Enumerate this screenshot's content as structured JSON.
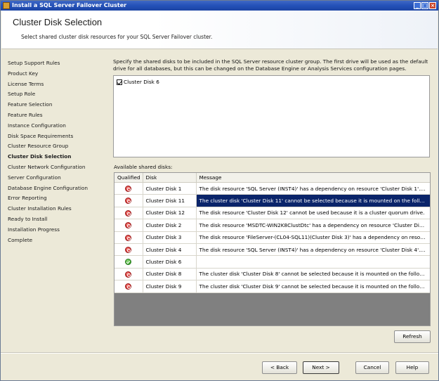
{
  "window": {
    "title": "Install a SQL Server Failover Cluster"
  },
  "header": {
    "title": "Cluster Disk Selection",
    "subtitle": "Select shared cluster disk resources for your SQL Server Failover cluster."
  },
  "nav": {
    "items": [
      {
        "label": "Setup Support Rules"
      },
      {
        "label": "Product Key"
      },
      {
        "label": "License Terms"
      },
      {
        "label": "Setup Role"
      },
      {
        "label": "Feature Selection"
      },
      {
        "label": "Feature Rules"
      },
      {
        "label": "Instance Configuration"
      },
      {
        "label": "Disk Space Requirements"
      },
      {
        "label": "Cluster Resource Group"
      },
      {
        "label": "Cluster Disk Selection"
      },
      {
        "label": "Cluster Network Configuration"
      },
      {
        "label": "Server Configuration"
      },
      {
        "label": "Database Engine Configuration"
      },
      {
        "label": "Error Reporting"
      },
      {
        "label": "Cluster Installation Rules"
      },
      {
        "label": "Ready to Install"
      },
      {
        "label": "Installation Progress"
      },
      {
        "label": "Complete"
      }
    ],
    "active_index": 9
  },
  "main": {
    "description": "Specify the shared disks to be included in the SQL Server resource cluster group. The first drive will be used as the default drive for all databases, but this can be changed on the Database Engine or Analysis Services configuration pages.",
    "selected_disks": [
      {
        "label": "Cluster Disk 6",
        "checked": true
      }
    ],
    "available_label": "Available shared disks:",
    "grid": {
      "columns": [
        "Qualified",
        "Disk",
        "Message"
      ],
      "rows": [
        {
          "status": "error",
          "disk": "Cluster Disk 1",
          "message": "The disk resource 'SQL Server (INST4)' has a dependency on resource 'Cluster Disk 1'. To ..."
        },
        {
          "status": "error",
          "disk": "Cluster Disk 11",
          "message": "The cluster disk 'Cluster Disk 11' cannot be selected because it is mounted on the followin...",
          "selected": true
        },
        {
          "status": "error",
          "disk": "Cluster Disk 12",
          "message": "The disk resource 'Cluster Disk 12' cannot be used because it is a cluster quorum drive."
        },
        {
          "status": "error",
          "disk": "Cluster Disk 2",
          "message": "The disk resource 'MSDTC-WIN2K8ClustDtc' has a dependency on resource 'Cluster Disk 2'..."
        },
        {
          "status": "error",
          "disk": "Cluster Disk 3",
          "message": "The disk resource 'FileServer-(CL04-SQL11)(Cluster Disk 3)' has a dependency on resourc..."
        },
        {
          "status": "error",
          "disk": "Cluster Disk 4",
          "message": "The disk resource 'SQL Server (INST4)' has a dependency on resource 'Cluster Disk 4'. To ..."
        },
        {
          "status": "ok",
          "disk": "Cluster Disk 6",
          "message": ""
        },
        {
          "status": "error",
          "disk": "Cluster Disk 8",
          "message": "The cluster disk 'Cluster Disk 8' cannot be selected because it is mounted on the following ..."
        },
        {
          "status": "error",
          "disk": "Cluster Disk 9",
          "message": "The cluster disk 'Cluster Disk 9' cannot be selected because it is mounted on the following ..."
        }
      ]
    },
    "refresh_label": "Refresh"
  },
  "footer": {
    "back_label": "< Back",
    "next_label": "Next >",
    "cancel_label": "Cancel",
    "help_label": "Help"
  },
  "icons": {
    "error": "error-circle-icon",
    "ok": "ok-check-icon"
  },
  "colors": {
    "titlebar": "#2451b8",
    "selection": "#0a246a",
    "error": "#c8282a",
    "ok": "#36a12a"
  }
}
